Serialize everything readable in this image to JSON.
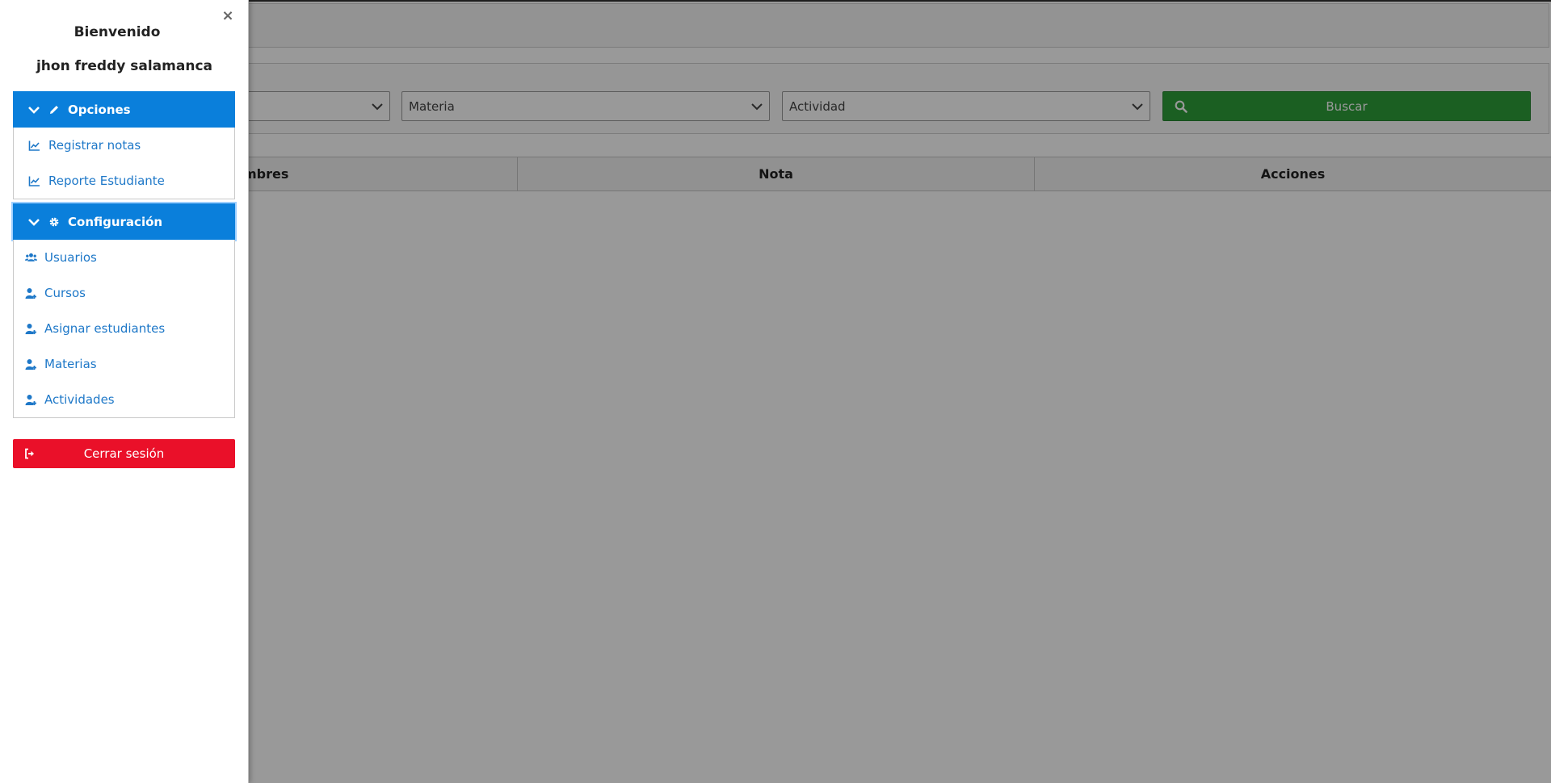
{
  "sidebar": {
    "close_label": "×",
    "welcome": "Bienvenido",
    "user_name": "jhon freddy salamanca",
    "sections": [
      {
        "title": "Opciones",
        "items": [
          {
            "label": "Registrar notas",
            "icon": "chart-line-icon"
          },
          {
            "label": "Reporte Estudiante",
            "icon": "chart-line-icon"
          }
        ]
      },
      {
        "title": "Configuración",
        "items": [
          {
            "label": "Usuarios",
            "icon": "users-icon"
          },
          {
            "label": "Cursos",
            "icon": "user-plus-icon"
          },
          {
            "label": "Asignar estudiantes",
            "icon": "user-plus-icon"
          },
          {
            "label": "Materias",
            "icon": "user-plus-icon"
          },
          {
            "label": "Actividades",
            "icon": "user-plus-icon"
          }
        ]
      }
    ],
    "logout_label": "Cerrar sesión"
  },
  "filters": {
    "materia_value": "Materia",
    "actividad_value": "Actividad",
    "search_label": "Buscar"
  },
  "table": {
    "columns": [
      "mbres",
      "Nota",
      "Acciones"
    ]
  },
  "colors": {
    "primary": "#0a7fdb",
    "danger": "#ea1029",
    "success": "#2e9e3a",
    "link": "#1e78c8"
  }
}
